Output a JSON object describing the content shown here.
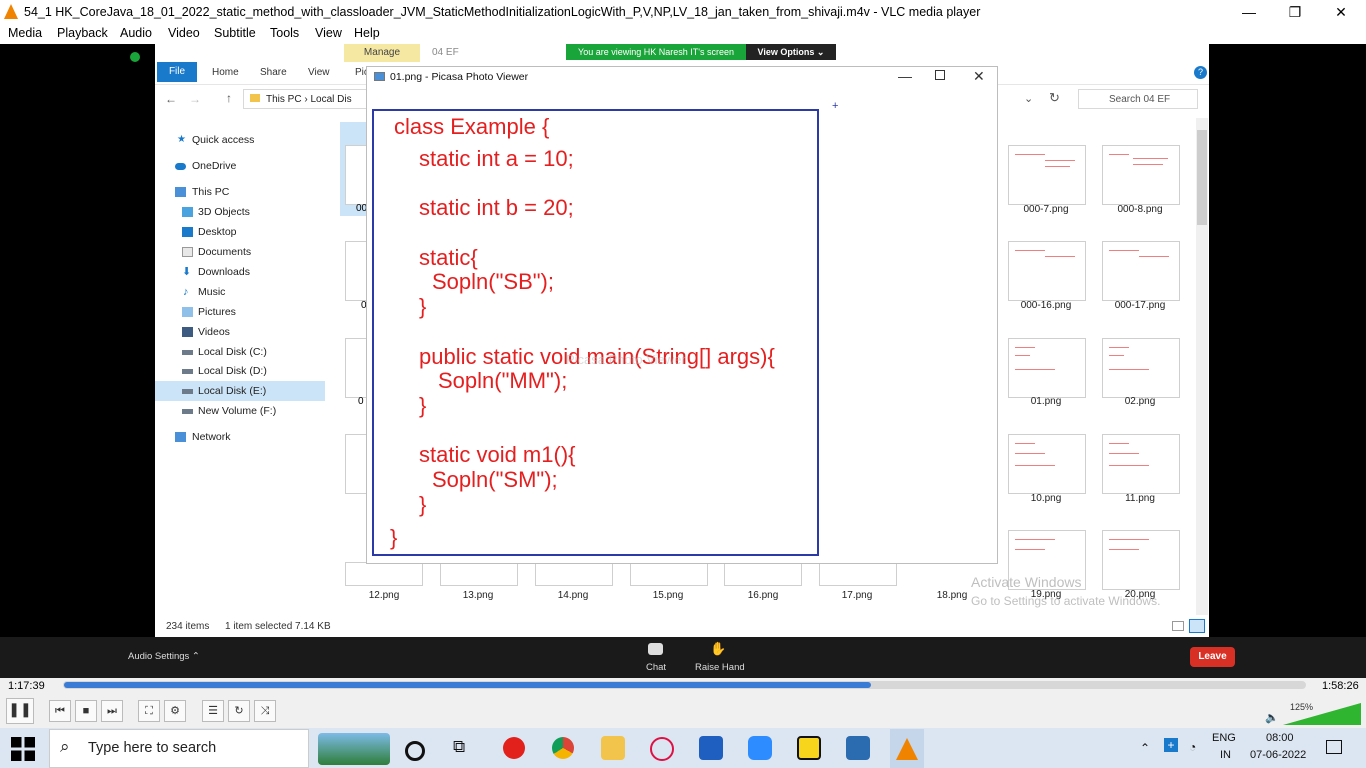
{
  "vlc": {
    "title": "54_1 HK_CoreJava_18_01_2022_static_method_with_classloader_JVM_StaticMethodInitializationLogicWith_P,V,NP,LV_18_jan_taken_from_shivaji.m4v - VLC media player",
    "window_controls": {
      "minimize": "—",
      "maximize": "❐",
      "close": "✕"
    },
    "menu": [
      "Media",
      "Playback",
      "Audio",
      "Video",
      "Subtitle",
      "Tools",
      "View",
      "Help"
    ],
    "time_current": "1:17:39",
    "time_total": "1:58:26",
    "progress_fraction": 0.65,
    "volume_label": "125%",
    "volume_fraction": 1.0
  },
  "zoom": {
    "banner": "You are viewing HK Naresh IT's screen",
    "view_options": "View Options ⌄",
    "audio_settings": "Audio Settings ⌃",
    "chat": "Chat",
    "raise_hand": "Raise Hand",
    "leave": "Leave"
  },
  "explorer": {
    "manage_tab": "Manage",
    "folder_title": "04 EF",
    "tabs": {
      "file": "File",
      "home": "Home",
      "share": "Share",
      "view": "View",
      "picture": "Pic"
    },
    "address": [
      "This PC",
      "Local Dis"
    ],
    "search_placeholder": "Search 04 EF",
    "nav": {
      "quick_access": "Quick access",
      "onedrive": "OneDrive",
      "this_pc": "This PC",
      "objects_3d": "3D Objects",
      "desktop": "Desktop",
      "documents": "Documents",
      "downloads": "Downloads",
      "music": "Music",
      "pictures": "Pictures",
      "videos": "Videos",
      "disk_c": "Local Disk (C:)",
      "disk_d": "Local Disk (D:)",
      "disk_e": "Local Disk (E:)",
      "disk_f": "New Volume (F:)",
      "network": "Network"
    },
    "thumb_labels": {
      "r1a": "000-7.png",
      "r1b": "000-8.png",
      "r2a": "000-16.png",
      "r2b": "000-17.png",
      "r3a": "01.png",
      "r3b": "02.png",
      "r4a": "10.png",
      "r4b": "11.png",
      "r5a": "19.png",
      "r5b": "20.png"
    },
    "bottom_labels": [
      "12.png",
      "13.png",
      "14.png",
      "15.png",
      "16.png",
      "17.png",
      "18.png"
    ],
    "partial_labels": {
      "a": "00",
      "b": "0",
      "c": "0"
    },
    "status_items": "234 items",
    "status_selected": "1 item selected  7.14 KB",
    "activate_title": "Activate Windows",
    "activate_sub": "Go to Settings to activate Windows."
  },
  "picasa": {
    "title": "01.png - Picasa Photo Viewer",
    "code": {
      "l1": "class Example {",
      "l2": "static int a = 10;",
      "l3": "static int b = 20;",
      "l4": "static{",
      "l5": "Sopln(\"SB\");",
      "l6": "}",
      "l7": "public static void main(String[] args){",
      "l8": "Sopln(\"MM\");",
      "l9": "}",
      "l10": "static void m1(){",
      "l11": "Sopln(\"SM\");",
      "l12": "}",
      "l13": "}"
    },
    "watermark": "Picasa Photo Viewer"
  },
  "taskbar": {
    "search_placeholder": "Type here to search",
    "lang_top": "ENG",
    "lang_bottom": "IN",
    "time": "08:00",
    "date": "07-06-2022"
  }
}
